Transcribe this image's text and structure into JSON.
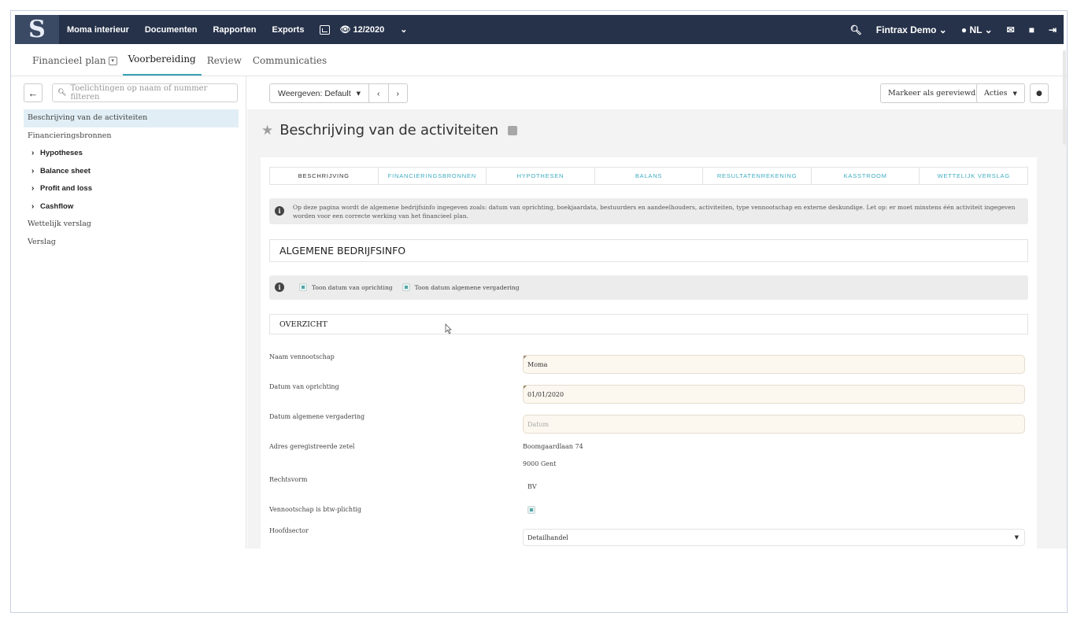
{
  "topbar": {
    "logo": "S",
    "company": "Moma interieur",
    "nav": [
      "Documenten",
      "Rapporten",
      "Exports"
    ],
    "period": "12/2020",
    "user": "Fintrax Demo",
    "language": "NL"
  },
  "subnav": {
    "tabs": [
      "Financieel plan",
      "Voorbereiding",
      "Review",
      "Communicaties"
    ],
    "active": "Voorbereiding"
  },
  "sidebar": {
    "filter_placeholder": "Toelichtingen op naam of nummer filteren",
    "items": [
      {
        "label": "Beschrijving van de activiteiten",
        "active": true
      },
      {
        "label": "Financieringsbronnen"
      },
      {
        "label": "Hypotheses",
        "sub": true
      },
      {
        "label": "Balance sheet",
        "sub": true
      },
      {
        "label": "Profit and loss",
        "sub": true
      },
      {
        "label": "Cashflow",
        "sub": true
      },
      {
        "label": "Wettelijk verslag"
      },
      {
        "label": "Verslag"
      }
    ]
  },
  "toolbar": {
    "view": "Weergeven: Default",
    "mark_reviewed": "Markeer als gereviewd",
    "actions": "Acties"
  },
  "page": {
    "title": "Beschrijving van de activiteiten",
    "tabs": [
      "BESCHRIJVING",
      "FINANCIERINGSBRONNEN",
      "HYPOTHESEN",
      "BALANS",
      "RESULTATENREKENING",
      "KASSTROOM",
      "WETTELIJK VERSLAG"
    ],
    "info": "Op deze pagina wordt de algemene bedrijfsinfo ingegeven zoals: datum van oprichting, boekjaardata, bestuurders en aandeelhouders, activiteiten, type vennootschap en externe deskundige. Let op: er moet minstens één activiteit ingegeven worden voor een correcte werking van het financieel plan.",
    "section_title": "ALGEMENE BEDRIJFSINFO",
    "checkbox_1": "Toon datum van oprichting",
    "checkbox_2": "Toon datum algemene vergadering",
    "overview_title": "OVERZICHT"
  },
  "form": {
    "name_label": "Naam vennootschap",
    "name_value": "Moma",
    "founding_label": "Datum van oprichting",
    "founding_value": "01/01/2020",
    "meeting_label": "Datum algemene vergadering",
    "meeting_placeholder": "Datum",
    "address_label": "Adres geregistreerde zetel",
    "address_line1": "Boomgaardlaan 74",
    "address_line2": "9000 Gent",
    "legal_form_label": "Rechtsvorm",
    "legal_form_value": "BV",
    "vat_label": "Vennootschap is btw-plichtig",
    "sector_label": "Hoofdsector",
    "sector_value": "Detailhandel"
  }
}
